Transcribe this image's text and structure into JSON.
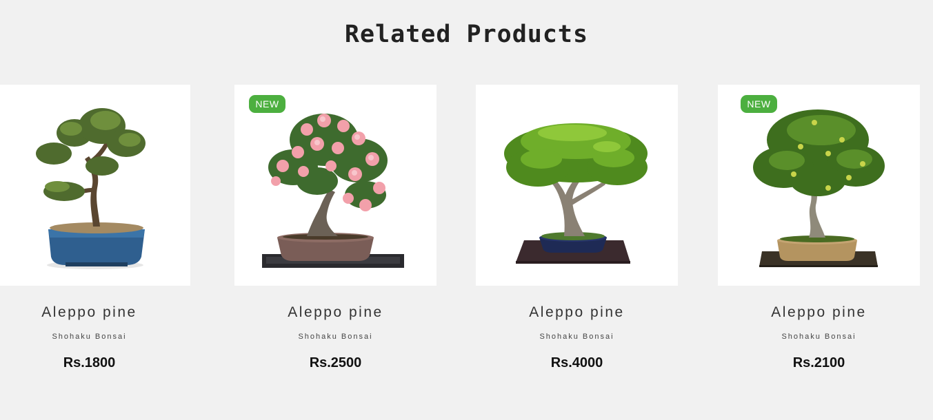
{
  "section": {
    "title": "Related Products"
  },
  "products": [
    {
      "name": "Aleppo pine",
      "brand": "Shohaku Bonsai",
      "price": "Rs.1800",
      "badge": "",
      "image_icon": "pine-bonsai-blue-pot-image"
    },
    {
      "name": "Aleppo pine",
      "brand": "Shohaku Bonsai",
      "price": "Rs.2500",
      "badge": "NEW",
      "image_icon": "azalea-bonsai-pink-flowers-image"
    },
    {
      "name": "Aleppo pine",
      "brand": "Shohaku Bonsai",
      "price": "Rs.4000",
      "badge": "",
      "image_icon": "maple-bonsai-navy-pot-image"
    },
    {
      "name": "Aleppo pine",
      "brand": "Shohaku Bonsai",
      "price": "Rs.2100",
      "badge": "NEW",
      "image_icon": "ficus-bonsai-clay-pot-image"
    }
  ],
  "colors": {
    "page_background": "#f1f1f1",
    "badge_background": "#4caf3f",
    "card_background": "#ffffff"
  }
}
